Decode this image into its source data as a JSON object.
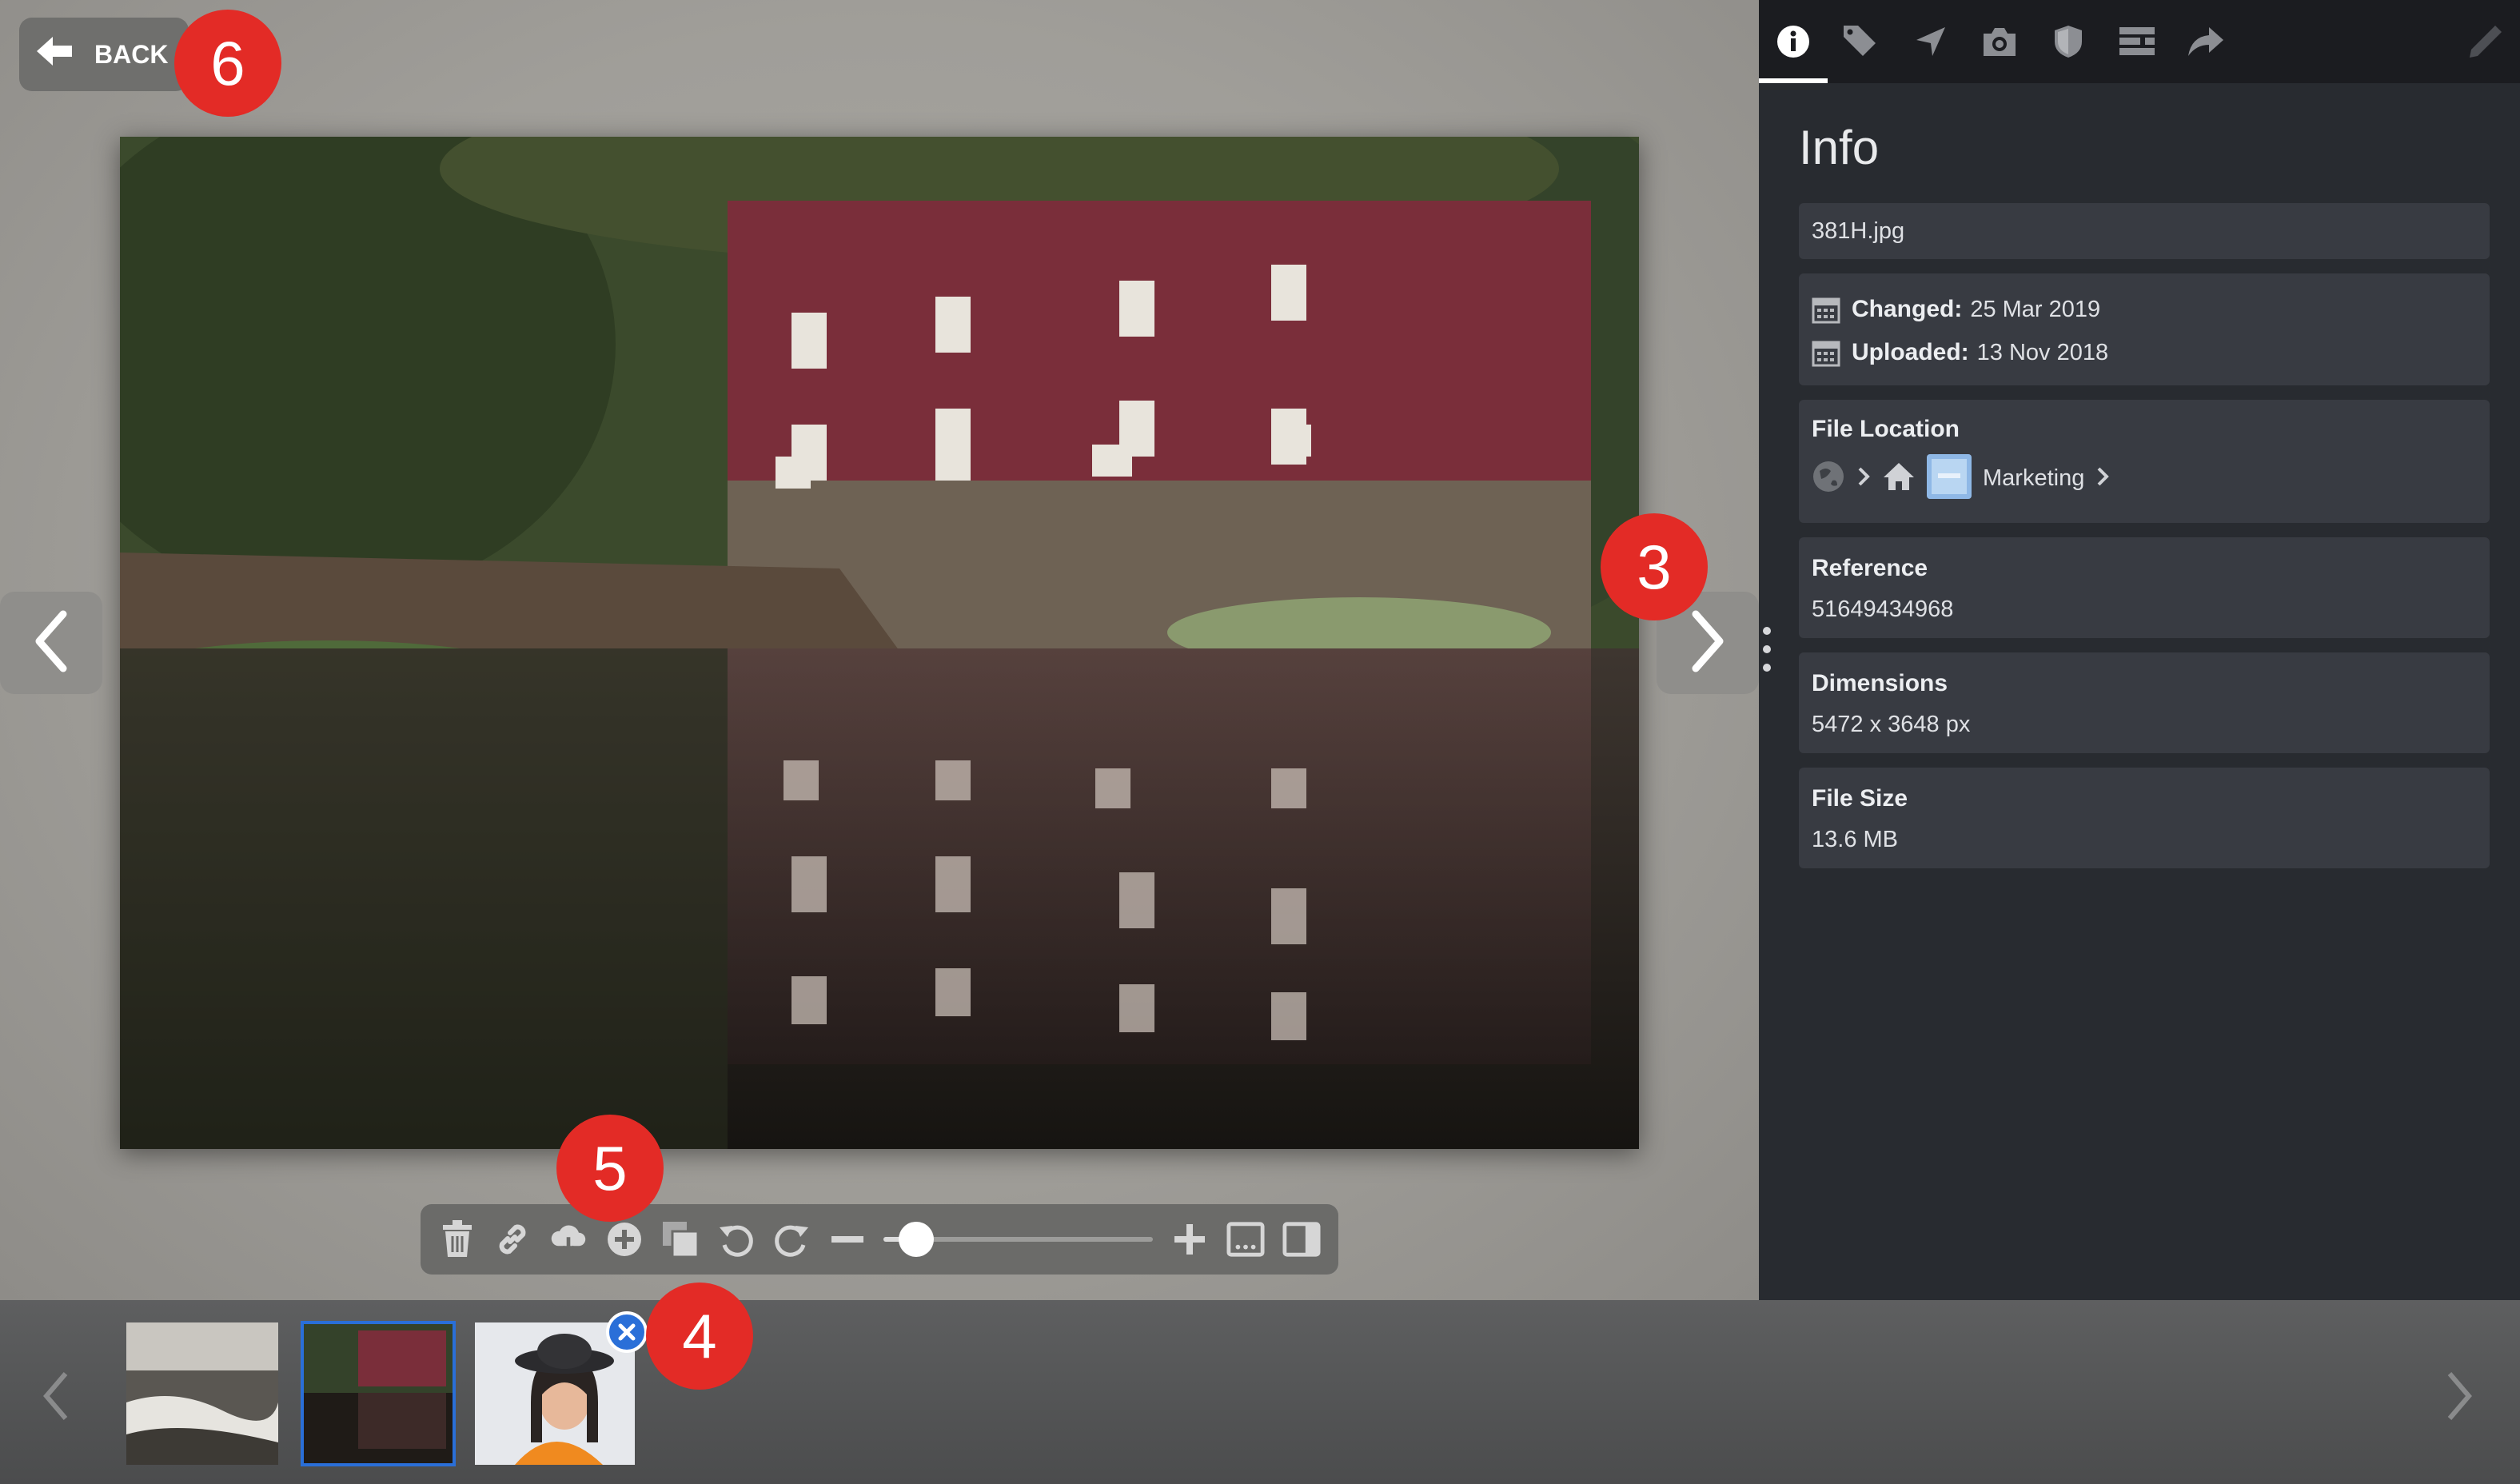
{
  "back": {
    "label": "BACK"
  },
  "badges": {
    "back": "6",
    "next": "3",
    "remove": "4",
    "toolbar": "5"
  },
  "icons": {
    "back": "arrow-left-icon",
    "prev": "chevron-left-icon",
    "next": "chevron-right-icon",
    "toolbar": [
      "trash-icon",
      "link-icon",
      "cloud-download-icon",
      "plus-circle-icon",
      "copy-icon",
      "rotate-left-icon",
      "rotate-right-icon",
      "zoom-out-icon",
      "zoom-in-icon",
      "filmstrip-icon",
      "sidebar-icon"
    ],
    "tabs": [
      "info-icon",
      "tag-icon",
      "location-icon",
      "camera-icon",
      "shield-icon",
      "list-icon",
      "share-icon",
      "edit-icon"
    ]
  },
  "zoom": {
    "level": 0.12
  },
  "panel": {
    "title": "Info",
    "filename": "381H.jpg",
    "changed_label": "Changed:",
    "changed_value": "25 Mar 2019",
    "uploaded_label": "Uploaded:",
    "uploaded_value": "13 Nov 2018",
    "file_location_label": "File Location",
    "location_folder": "Marketing",
    "reference_label": "Reference",
    "reference_value": "51649434968",
    "dimensions_label": "Dimensions",
    "dimensions_value": "5472 x 3648 px",
    "filesize_label": "File Size",
    "filesize_value": "13.6 MB"
  },
  "colors": {
    "badge": "#e32b26",
    "panel_bg": "#282b30",
    "card_bg": "#383b42",
    "accent_blue": "#2a6fd8"
  }
}
